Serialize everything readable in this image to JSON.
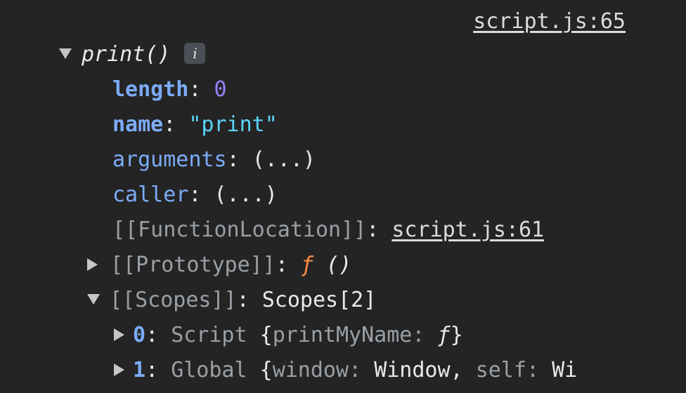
{
  "source_link": "script.js:65",
  "function": {
    "name": "print()",
    "info_badge": "i"
  },
  "props": {
    "length_key": "length",
    "length_value": "0",
    "name_key": "name",
    "name_value": "\"print\"",
    "arguments_key": "arguments",
    "arguments_value": "(...)",
    "caller_key": "caller",
    "caller_value": "(...)",
    "location_key": "[[FunctionLocation]]",
    "location_value": "script.js:61",
    "prototype_key": "[[Prototype]]",
    "prototype_f": "ƒ",
    "prototype_parens": "()",
    "scopes_key": "[[Scopes]]",
    "scopes_value": "Scopes[2]"
  },
  "scopes": [
    {
      "index": "0",
      "type": "Script",
      "open": "{",
      "key1": "printMyName",
      "val1": "ƒ",
      "close": "}"
    },
    {
      "index": "1",
      "type": "Global",
      "open": "{",
      "key1": "window",
      "val1": "Window",
      "sep": ",",
      "key2": "self",
      "val2": "Wi"
    }
  ],
  "colors": {
    "background": "#242424",
    "key": "#7cacf8",
    "number": "#9980ff",
    "string": "#5cd5fb",
    "function_symbol": "#ff8c42",
    "internal": "#9aa0a6"
  }
}
